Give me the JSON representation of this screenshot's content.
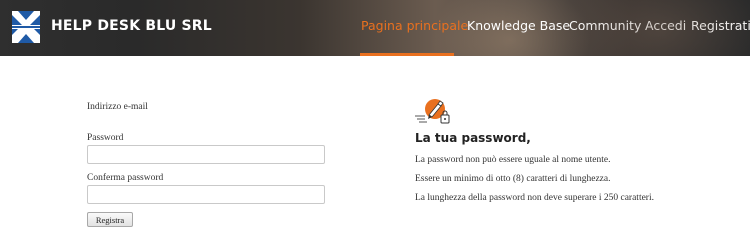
{
  "header": {
    "brand": "HELP DESK BLU SRL",
    "logo_icon": "blue-white-cross-logo",
    "nav": [
      {
        "label": "Pagina principale",
        "active": true
      },
      {
        "label": "Knowledge Base",
        "active": false
      },
      {
        "label": "Community",
        "active": false
      },
      {
        "label": "Accedi",
        "active": false
      },
      {
        "label": "Registrati",
        "active": false
      }
    ],
    "accent_color": "#e9701f"
  },
  "form": {
    "email_label": "Indirizzo e-mail",
    "password_label": "Password",
    "password_value": "",
    "confirm_label": "Conferma password",
    "confirm_value": "",
    "submit_label": "Registra"
  },
  "info": {
    "icon": "password-pen-lock-icon",
    "title": "La tua password,",
    "rules": [
      "La password non può essere uguale al nome utente.",
      "Essere un minimo di otto (8) caratteri di lunghezza.",
      "La lunghezza della password non deve superare i 250 caratteri."
    ]
  }
}
